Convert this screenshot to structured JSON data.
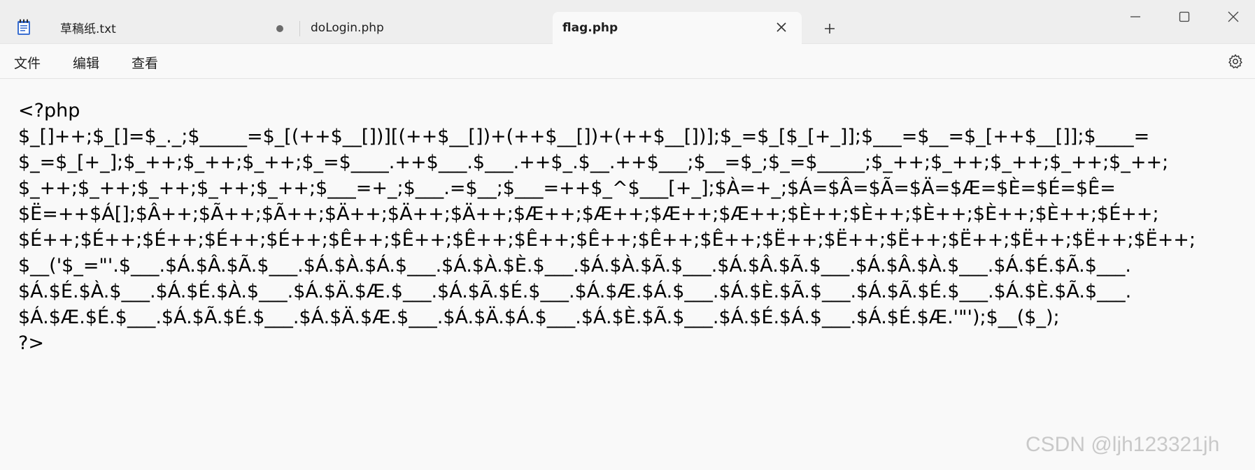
{
  "tabs": [
    {
      "label": "草稿纸.txt",
      "modified": true
    },
    {
      "label": "doLogin.php",
      "modified": false
    },
    {
      "label": "flag.php",
      "active": true
    }
  ],
  "icons": {
    "app": "notepad-icon",
    "close_tab": "close-icon",
    "new_tab": "plus-icon",
    "minimize": "minimize-icon",
    "maximize": "maximize-icon",
    "close_window": "close-icon",
    "settings": "gear-icon"
  },
  "menu": {
    "file": "文件",
    "edit": "编辑",
    "view": "查看"
  },
  "editor": {
    "lines": [
      "<?php",
      "$_[]++;$_[]=$_._;$_____=$_[(++$__[])][(++$__[])+(++$__[])+(++$__[])];$_=$_[$_[+_]];$___=$__=$_[++$__[]];$____=",
      "$_=$_[+_];$_++;$_++;$_++;$_=$____.++$___.$___.++$_.$__.++$___;$__=$_;$_=$_____;$_++;$_++;$_++;$_++;$_++;",
      "$_++;$_++;$_++;$_++;$_++;$___=+_;$___.=$__;$___=++$_^$___[+_];$À=+_;$Á=$Â=$Ã=$Ä=$Æ=$È=$É=$Ê=",
      "$Ë=++$Á[];$Â++;$Ã++;$Ã++;$Ä++;$Ä++;$Ä++;$Æ++;$Æ++;$Æ++;$Æ++;$È++;$È++;$È++;$È++;$È++;$É++;",
      "$É++;$É++;$É++;$É++;$É++;$Ê++;$Ê++;$Ê++;$Ê++;$Ê++;$Ê++;$Ê++;$Ë++;$Ë++;$Ë++;$Ë++;$Ë++;$Ë++;$Ë++;",
      "$__('$_=\"'.$___.$Á.$Â.$Ã.$___.$Á.$À.$Á.$___.$Á.$À.$È.$___.$Á.$À.$Ã.$___.$Á.$Â.$Ã.$___.$Á.$Â.$À.$___.$Á.$É.$Ã.$___.",
      "$Á.$É.$À.$___.$Á.$É.$À.$___.$Á.$Ä.$Æ.$___.$Á.$Ã.$É.$___.$Á.$Æ.$Á.$___.$Á.$È.$Ã.$___.$Á.$Ã.$É.$___.$Á.$È.$Ã.$___.",
      "$Á.$Æ.$É.$___.$Á.$Ã.$É.$___.$Á.$Ä.$Æ.$___.$Á.$Ä.$Á.$___.$Á.$È.$Ã.$___.$Á.$É.$Á.$___.$Á.$É.$Æ.'\"');$__($_);",
      "?>"
    ]
  },
  "watermark": "CSDN @ljh123321jh"
}
